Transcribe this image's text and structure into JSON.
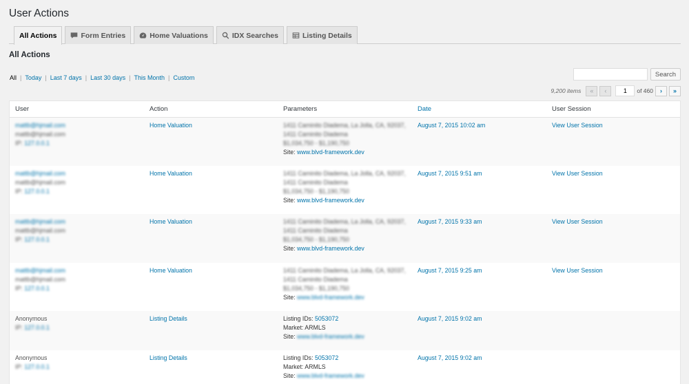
{
  "page": {
    "title": "User Actions",
    "section": "All Actions"
  },
  "tabs": [
    {
      "label": "All Actions",
      "icon": "none"
    },
    {
      "label": "Form Entries",
      "icon": "comment-icon"
    },
    {
      "label": "Home Valuations",
      "icon": "dashboard-icon"
    },
    {
      "label": "IDX Searches",
      "icon": "search-icon"
    },
    {
      "label": "Listing Details",
      "icon": "table-icon"
    }
  ],
  "filters": [
    "All",
    "Today",
    "Last 7 days",
    "Last 30 days",
    "This Month",
    "Custom"
  ],
  "search": {
    "button": "Search",
    "value": ""
  },
  "pagination": {
    "items": "9,200 items",
    "current": "1",
    "of": "of 460",
    "first": "«",
    "prev": "‹",
    "next": "›",
    "last": "»"
  },
  "table": {
    "headers": {
      "user": "User",
      "action": "Action",
      "parameters": "Parameters",
      "date": "Date",
      "session": "User Session"
    },
    "rows": [
      {
        "email": "mattb@hjmail.com",
        "email2": "mattb@hjmail.com",
        "ip_prefix": "IP: ",
        "ip": "127.0.0.1",
        "action": "Home Valuation",
        "p1": "1411 Caminito Diadema, La Jolla, CA, 92037,",
        "p2": "1411 Caminito Diadema",
        "p3": "$1,034,750 - $1,190,750",
        "site_label": "Site: ",
        "site": "www.blvd-framework.dev",
        "date": "August 7, 2015 10:02 am",
        "session": "View User Session"
      },
      {
        "email": "mattb@hjmail.com",
        "email2": "mattb@hjmail.com",
        "ip_prefix": "IP: ",
        "ip": "127.0.0.1",
        "action": "Home Valuation",
        "p1": "1411 Caminito Diadema, La Jolla, CA, 92037,",
        "p2": "1411 Caminito Diadema",
        "p3": "$1,034,750 - $1,190,750",
        "site_label": "Site: ",
        "site": "www.blvd-framework.dev",
        "date": "August 7, 2015 9:51 am",
        "session": "View User Session"
      },
      {
        "email": "mattb@hjmail.com",
        "email2": "mattb@hjmail.com",
        "ip_prefix": "IP: ",
        "ip": "127.0.0.1",
        "action": "Home Valuation",
        "p1": "1411 Caminito Diadema, La Jolla, CA, 92037,",
        "p2": "1411 Caminito Diadema",
        "p3": "$1,034,750 - $1,190,750",
        "site_label": "Site: ",
        "site": "www.blvd-framework.dev",
        "date": "August 7, 2015 9:33 am",
        "session": "View User Session"
      },
      {
        "email": "mattb@hjmail.com",
        "email2": "mattb@hjmail.com",
        "ip_prefix": "IP: ",
        "ip": "127.0.0.1",
        "action": "Home Valuation",
        "p1": "1411 Caminito Diadema, La Jolla, CA, 92037,",
        "p2": "1411 Caminito Diadema",
        "p3": "$1,034,750 - $1,190,750",
        "site_label": "Site: ",
        "site": "www.blvd-framework.dev",
        "date": "August 7, 2015 9:25 am",
        "session": "View User Session"
      },
      {
        "user": "Anonymous",
        "ip_prefix": "IP: ",
        "ip": "127.0.0.1",
        "action": "Listing Details",
        "listing_label": "Listing IDs: ",
        "listing_id": "5053072",
        "market": "Market: ARMLS",
        "site_label": "Site: ",
        "site": "www.blvd-framework.dev",
        "date": "August 7, 2015 9:02 am"
      },
      {
        "user": "Anonymous",
        "ip_prefix": "IP: ",
        "ip": "127.0.0.1",
        "action": "Listing Details",
        "listing_label": "Listing IDs: ",
        "listing_id": "5053072",
        "market": "Market: ARMLS",
        "site_label": "Site: ",
        "site": "www.blvd-framework.dev",
        "date": "August 7, 2015 9:02 am"
      }
    ]
  }
}
